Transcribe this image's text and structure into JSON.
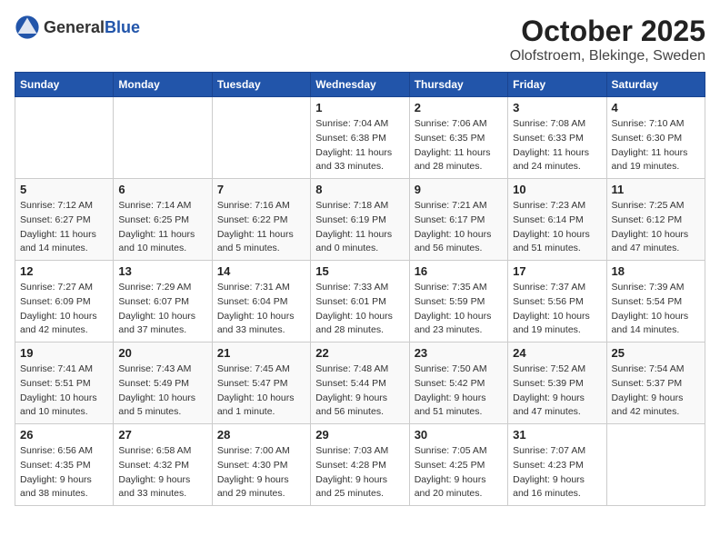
{
  "header": {
    "logo_general": "General",
    "logo_blue": "Blue",
    "month_year": "October 2025",
    "location": "Olofstroem, Blekinge, Sweden"
  },
  "weekdays": [
    "Sunday",
    "Monday",
    "Tuesday",
    "Wednesday",
    "Thursday",
    "Friday",
    "Saturday"
  ],
  "weeks": [
    [
      {
        "day": "",
        "empty": true
      },
      {
        "day": "",
        "empty": true
      },
      {
        "day": "",
        "empty": true
      },
      {
        "day": "1",
        "sunrise": "7:04 AM",
        "sunset": "6:38 PM",
        "daylight": "11 hours and 33 minutes."
      },
      {
        "day": "2",
        "sunrise": "7:06 AM",
        "sunset": "6:35 PM",
        "daylight": "11 hours and 28 minutes."
      },
      {
        "day": "3",
        "sunrise": "7:08 AM",
        "sunset": "6:33 PM",
        "daylight": "11 hours and 24 minutes."
      },
      {
        "day": "4",
        "sunrise": "7:10 AM",
        "sunset": "6:30 PM",
        "daylight": "11 hours and 19 minutes."
      }
    ],
    [
      {
        "day": "5",
        "sunrise": "7:12 AM",
        "sunset": "6:27 PM",
        "daylight": "11 hours and 14 minutes."
      },
      {
        "day": "6",
        "sunrise": "7:14 AM",
        "sunset": "6:25 PM",
        "daylight": "11 hours and 10 minutes."
      },
      {
        "day": "7",
        "sunrise": "7:16 AM",
        "sunset": "6:22 PM",
        "daylight": "11 hours and 5 minutes."
      },
      {
        "day": "8",
        "sunrise": "7:18 AM",
        "sunset": "6:19 PM",
        "daylight": "11 hours and 0 minutes."
      },
      {
        "day": "9",
        "sunrise": "7:21 AM",
        "sunset": "6:17 PM",
        "daylight": "10 hours and 56 minutes."
      },
      {
        "day": "10",
        "sunrise": "7:23 AM",
        "sunset": "6:14 PM",
        "daylight": "10 hours and 51 minutes."
      },
      {
        "day": "11",
        "sunrise": "7:25 AM",
        "sunset": "6:12 PM",
        "daylight": "10 hours and 47 minutes."
      }
    ],
    [
      {
        "day": "12",
        "sunrise": "7:27 AM",
        "sunset": "6:09 PM",
        "daylight": "10 hours and 42 minutes."
      },
      {
        "day": "13",
        "sunrise": "7:29 AM",
        "sunset": "6:07 PM",
        "daylight": "10 hours and 37 minutes."
      },
      {
        "day": "14",
        "sunrise": "7:31 AM",
        "sunset": "6:04 PM",
        "daylight": "10 hours and 33 minutes."
      },
      {
        "day": "15",
        "sunrise": "7:33 AM",
        "sunset": "6:01 PM",
        "daylight": "10 hours and 28 minutes."
      },
      {
        "day": "16",
        "sunrise": "7:35 AM",
        "sunset": "5:59 PM",
        "daylight": "10 hours and 23 minutes."
      },
      {
        "day": "17",
        "sunrise": "7:37 AM",
        "sunset": "5:56 PM",
        "daylight": "10 hours and 19 minutes."
      },
      {
        "day": "18",
        "sunrise": "7:39 AM",
        "sunset": "5:54 PM",
        "daylight": "10 hours and 14 minutes."
      }
    ],
    [
      {
        "day": "19",
        "sunrise": "7:41 AM",
        "sunset": "5:51 PM",
        "daylight": "10 hours and 10 minutes."
      },
      {
        "day": "20",
        "sunrise": "7:43 AM",
        "sunset": "5:49 PM",
        "daylight": "10 hours and 5 minutes."
      },
      {
        "day": "21",
        "sunrise": "7:45 AM",
        "sunset": "5:47 PM",
        "daylight": "10 hours and 1 minute."
      },
      {
        "day": "22",
        "sunrise": "7:48 AM",
        "sunset": "5:44 PM",
        "daylight": "9 hours and 56 minutes."
      },
      {
        "day": "23",
        "sunrise": "7:50 AM",
        "sunset": "5:42 PM",
        "daylight": "9 hours and 51 minutes."
      },
      {
        "day": "24",
        "sunrise": "7:52 AM",
        "sunset": "5:39 PM",
        "daylight": "9 hours and 47 minutes."
      },
      {
        "day": "25",
        "sunrise": "7:54 AM",
        "sunset": "5:37 PM",
        "daylight": "9 hours and 42 minutes."
      }
    ],
    [
      {
        "day": "26",
        "sunrise": "6:56 AM",
        "sunset": "4:35 PM",
        "daylight": "9 hours and 38 minutes."
      },
      {
        "day": "27",
        "sunrise": "6:58 AM",
        "sunset": "4:32 PM",
        "daylight": "9 hours and 33 minutes."
      },
      {
        "day": "28",
        "sunrise": "7:00 AM",
        "sunset": "4:30 PM",
        "daylight": "9 hours and 29 minutes."
      },
      {
        "day": "29",
        "sunrise": "7:03 AM",
        "sunset": "4:28 PM",
        "daylight": "9 hours and 25 minutes."
      },
      {
        "day": "30",
        "sunrise": "7:05 AM",
        "sunset": "4:25 PM",
        "daylight": "9 hours and 20 minutes."
      },
      {
        "day": "31",
        "sunrise": "7:07 AM",
        "sunset": "4:23 PM",
        "daylight": "9 hours and 16 minutes."
      },
      {
        "day": "",
        "empty": true
      }
    ]
  ]
}
